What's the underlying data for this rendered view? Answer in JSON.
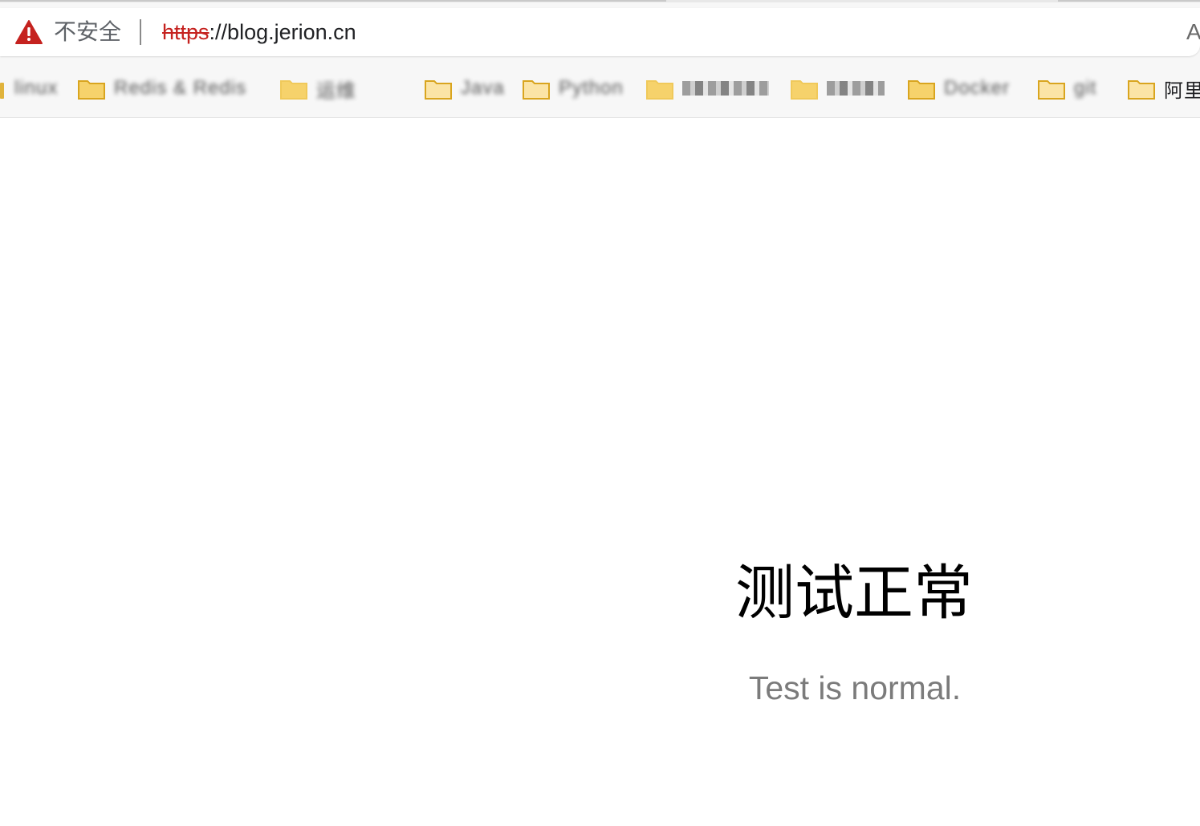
{
  "browser": {
    "security_label": "不安全",
    "url_scheme": "https",
    "url_rest": "://blog.jerion.cn",
    "reader_glyph": "A"
  },
  "bookmarks": [
    {
      "label": "linux",
      "folder": false
    },
    {
      "label": "Redis & Redis",
      "folder": true
    },
    {
      "label": "运维",
      "folder": true
    },
    {
      "label": "Java",
      "folder": true
    },
    {
      "label": "Python",
      "folder": true
    },
    {
      "label": "",
      "folder": true
    },
    {
      "label": "",
      "folder": true
    },
    {
      "label": "Docker",
      "folder": true
    },
    {
      "label": "git",
      "folder": true
    },
    {
      "label": "阿里",
      "folder": true
    }
  ],
  "page": {
    "heading": "测试正常",
    "subtitle": "Test is normal."
  },
  "colors": {
    "warning_red": "#c5221f",
    "folder_yellow": "#f6d26b",
    "subtitle_gray": "#7b7b7b"
  },
  "icons": {
    "security": "warning-triangle-icon",
    "bookmark_folder": "folder-icon"
  }
}
